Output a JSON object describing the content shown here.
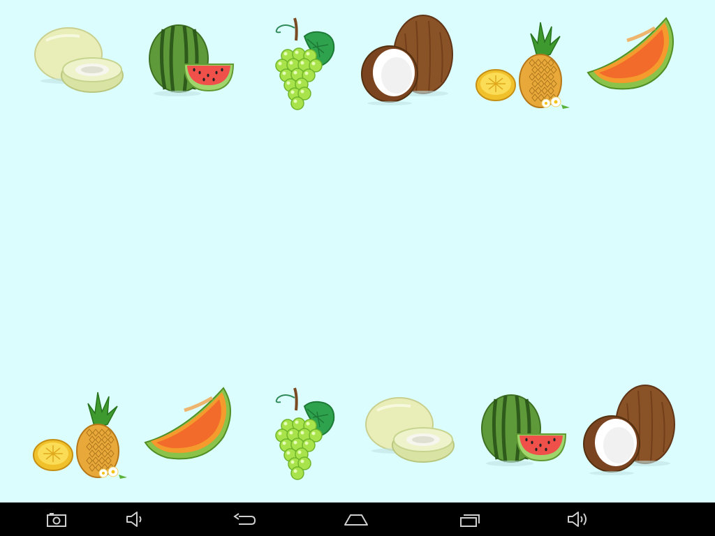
{
  "board": {
    "top_row": [
      "honeydew",
      "watermelon",
      "grapes",
      "coconut",
      "pineapple",
      "cantaloupe"
    ],
    "bottom_row": [
      "pineapple",
      "cantaloupe",
      "grapes",
      "honeydew",
      "watermelon",
      "coconut"
    ]
  },
  "nav_bar": {
    "buttons": [
      "screenshot-icon",
      "volume-down-icon",
      "back-icon",
      "home-icon",
      "recent-apps-icon",
      "volume-up-icon"
    ]
  },
  "colors": {
    "background": "#dcfdfd",
    "nav_bar": "#000000",
    "nav_icon": "#cfcfcf"
  }
}
